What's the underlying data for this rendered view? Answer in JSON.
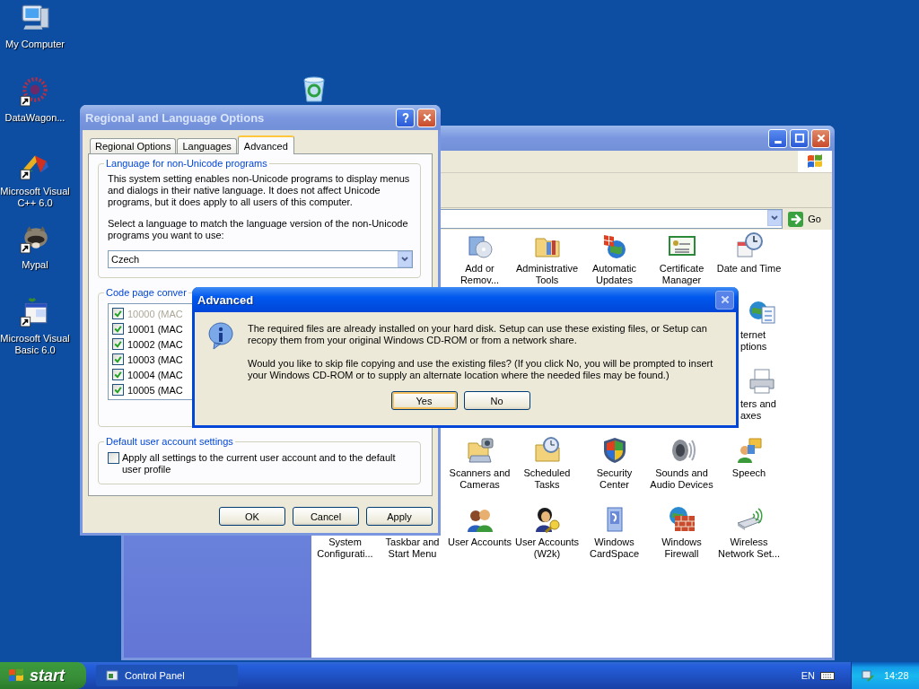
{
  "desktop": {
    "icons": [
      {
        "label": "My Computer",
        "kind": "computer",
        "shortcut": false
      },
      {
        "label": "DataWagon...",
        "kind": "flower",
        "shortcut": true
      },
      {
        "label": "Microsoft Visual C++ 6.0",
        "kind": "pinwheel",
        "shortcut": true
      },
      {
        "label": "Mypal",
        "kind": "animal",
        "shortcut": true
      },
      {
        "label": "Microsoft Visual Basic 6.0",
        "kind": "calc",
        "shortcut": true
      }
    ],
    "recycle_bin": {
      "kind": "recycle"
    }
  },
  "control_panel": {
    "go_label": "Go",
    "items": [
      {
        "lines": [
          "Add or",
          "Remov..."
        ],
        "kind": "cdbox"
      },
      {
        "lines": [
          "Administrative",
          "Tools"
        ],
        "kind": "tools"
      },
      {
        "lines": [
          "Automatic",
          "Updates"
        ],
        "kind": "globeflag"
      },
      {
        "lines": [
          "Certificate",
          "Manager"
        ],
        "kind": "certificate"
      },
      {
        "lines": [
          "Date and Time"
        ],
        "kind": "clock"
      },
      {
        "lines": [
          "ternet",
          "ptions"
        ],
        "kind": "globe"
      },
      {
        "lines": [
          "ters and",
          "axes"
        ],
        "kind": "printer"
      },
      {
        "lines": [
          "Scanners and",
          "Cameras"
        ],
        "kind": "scanner"
      },
      {
        "lines": [
          "Scheduled",
          "Tasks"
        ],
        "kind": "folderclock"
      },
      {
        "lines": [
          "Security",
          "Center"
        ],
        "kind": "shield"
      },
      {
        "lines": [
          "Sounds and",
          "Audio Devices"
        ],
        "kind": "speaker"
      },
      {
        "lines": [
          "Speech"
        ],
        "kind": "speech"
      },
      {
        "lines": [
          "System",
          "Configurati..."
        ],
        "kind": "none"
      },
      {
        "lines": [
          "Taskbar and",
          "Start Menu"
        ],
        "kind": "none"
      },
      {
        "lines": [
          "User Accounts"
        ],
        "kind": "users"
      },
      {
        "lines": [
          "User Accounts",
          "(W2k)"
        ],
        "kind": "userkey"
      },
      {
        "lines": [
          "Windows",
          "CardSpace"
        ],
        "kind": "card"
      },
      {
        "lines": [
          "Windows",
          "Firewall"
        ],
        "kind": "firewall"
      },
      {
        "lines": [
          "Wireless",
          "Network Set..."
        ],
        "kind": "wireless"
      }
    ]
  },
  "regional_dialog": {
    "title": "Regional and Language Options",
    "tabs": [
      {
        "label": "Regional Options",
        "selected": false
      },
      {
        "label": "Languages",
        "selected": false
      },
      {
        "label": "Advanced",
        "selected": true
      }
    ],
    "language_group": {
      "legend": "Language for non-Unicode programs",
      "description": "This system setting enables non-Unicode programs to display menus and dialogs in their native language. It does not affect Unicode programs, but it does apply to all users of this computer.",
      "prompt": "Select a language to match the language version of the non-Unicode programs you want to use:",
      "value": "Czech"
    },
    "code_page_group": {
      "legend": "Code page conver",
      "items": [
        {
          "label": "10000 (MAC",
          "checked": true,
          "disabled": true
        },
        {
          "label": "10001 (MAC",
          "checked": true,
          "disabled": false
        },
        {
          "label": "10002 (MAC",
          "checked": true,
          "disabled": false
        },
        {
          "label": "10003 (MAC",
          "checked": true,
          "disabled": false
        },
        {
          "label": "10004 (MAC",
          "checked": true,
          "disabled": false
        },
        {
          "label": "10005 (MAC",
          "checked": true,
          "disabled": false
        }
      ]
    },
    "default_group": {
      "legend": "Default user account settings",
      "label": "Apply all settings to the current user account and to the default user profile",
      "checked": false
    },
    "buttons": [
      "OK",
      "Cancel",
      "Apply"
    ]
  },
  "advanced_dialog": {
    "title": "Advanced",
    "paragraphs": [
      "The required files are already installed on your hard disk. Setup can use these existing files, or Setup can recopy them from your original Windows CD-ROM or from a network share.",
      "Would you like to skip file copying and use the existing files? (If you click No, you will be prompted to insert your Windows CD-ROM or to supply an alternate location where the needed files may be found.)"
    ],
    "buttons": [
      {
        "label": "Yes",
        "default": true
      },
      {
        "label": "No",
        "default": false
      }
    ]
  },
  "taskbar": {
    "start": "start",
    "tasks": [
      {
        "label": "Control Panel"
      }
    ],
    "language": "EN",
    "clock": "14:28"
  }
}
